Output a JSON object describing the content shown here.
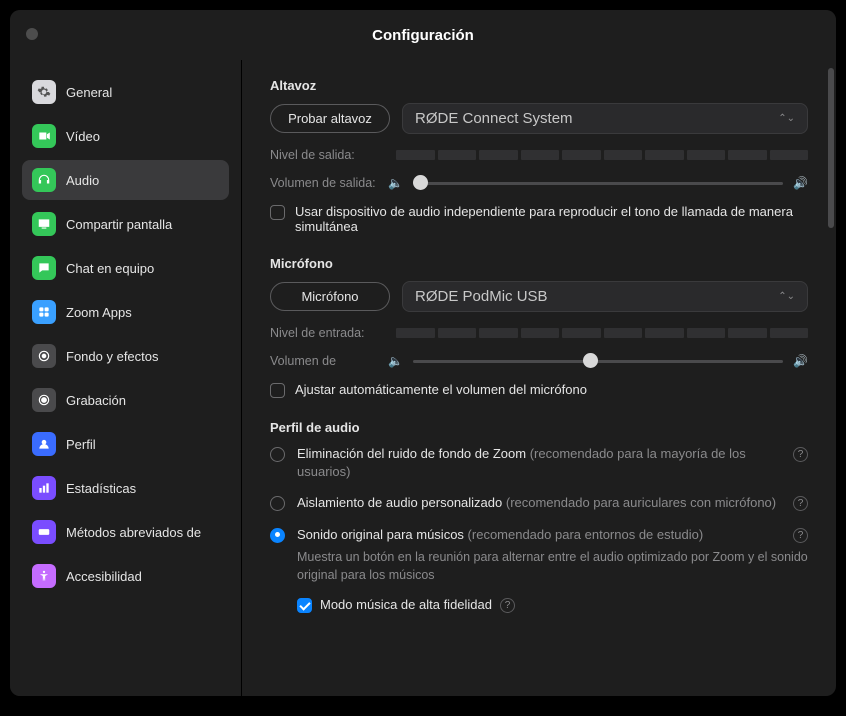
{
  "window": {
    "title": "Configuración"
  },
  "sidebar": {
    "items": [
      {
        "label": "General"
      },
      {
        "label": "Vídeo"
      },
      {
        "label": "Audio"
      },
      {
        "label": "Compartir pantalla"
      },
      {
        "label": "Chat en equipo"
      },
      {
        "label": "Zoom Apps"
      },
      {
        "label": "Fondo y efectos"
      },
      {
        "label": "Grabación"
      },
      {
        "label": "Perfil"
      },
      {
        "label": "Estadísticas"
      },
      {
        "label": "Métodos abreviados de"
      },
      {
        "label": "Accesibilidad"
      }
    ]
  },
  "speaker": {
    "heading": "Altavoz",
    "test_btn": "Probar altavoz",
    "device": "RØDE Connect System",
    "output_level_label": "Nivel de salida:",
    "output_volume_label": "Volumen de salida:",
    "separate_device_label": "Usar dispositivo de audio independiente para reproducir el tono de llamada de manera simultánea"
  },
  "mic": {
    "heading": "Micrófono",
    "test_btn": "Micrófono",
    "device": "RØDE PodMic USB",
    "input_level_label": "Nivel de entrada:",
    "input_volume_label": "Volumen de",
    "auto_adjust_label": "Ajustar automáticamente el volumen del micrófono"
  },
  "profile": {
    "heading": "Perfil de audio",
    "opt1_main": "Eliminación del ruido de fondo de Zoom",
    "opt1_rec": " (recomendado para la mayoría de los usuarios)",
    "opt2_main": "Aislamiento de audio personalizado",
    "opt2_rec": " (recomendado para auriculares con micrófono)",
    "opt3_main": "Sonido original para músicos",
    "opt3_rec": " (recomendado para entornos de estudio)",
    "opt3_sub": "Muestra un botón en la reunión para alternar entre el audio optimizado por Zoom y el sonido original para los músicos",
    "hifi_label": "Modo música de alta fidelidad"
  }
}
